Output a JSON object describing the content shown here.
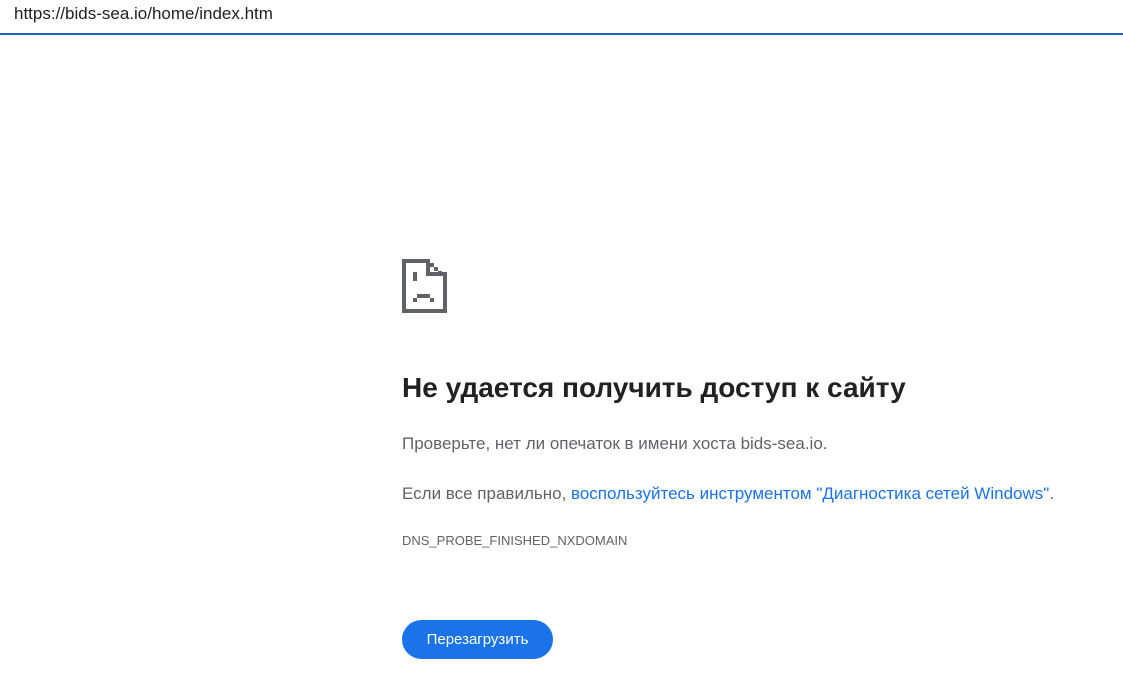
{
  "address_bar": {
    "url": "https://bids-sea.io/home/index.htm"
  },
  "error": {
    "icon": "sad-document-icon",
    "title": "Не удается получить доступ к сайту",
    "check_text": "Проверьте, нет ли опечаток в имени хоста bids-sea.io.",
    "diag_prefix": "Если все правильно, ",
    "diag_link": "воспользуйтесь инструментом \"Диагностика сетей Windows\"",
    "diag_suffix": ".",
    "code": "DNS_PROBE_FINISHED_NXDOMAIN",
    "reload_label": "Перезагрузить"
  },
  "colors": {
    "accent": "#1a73e8",
    "text": "#202124",
    "secondary": "#5f6368"
  }
}
